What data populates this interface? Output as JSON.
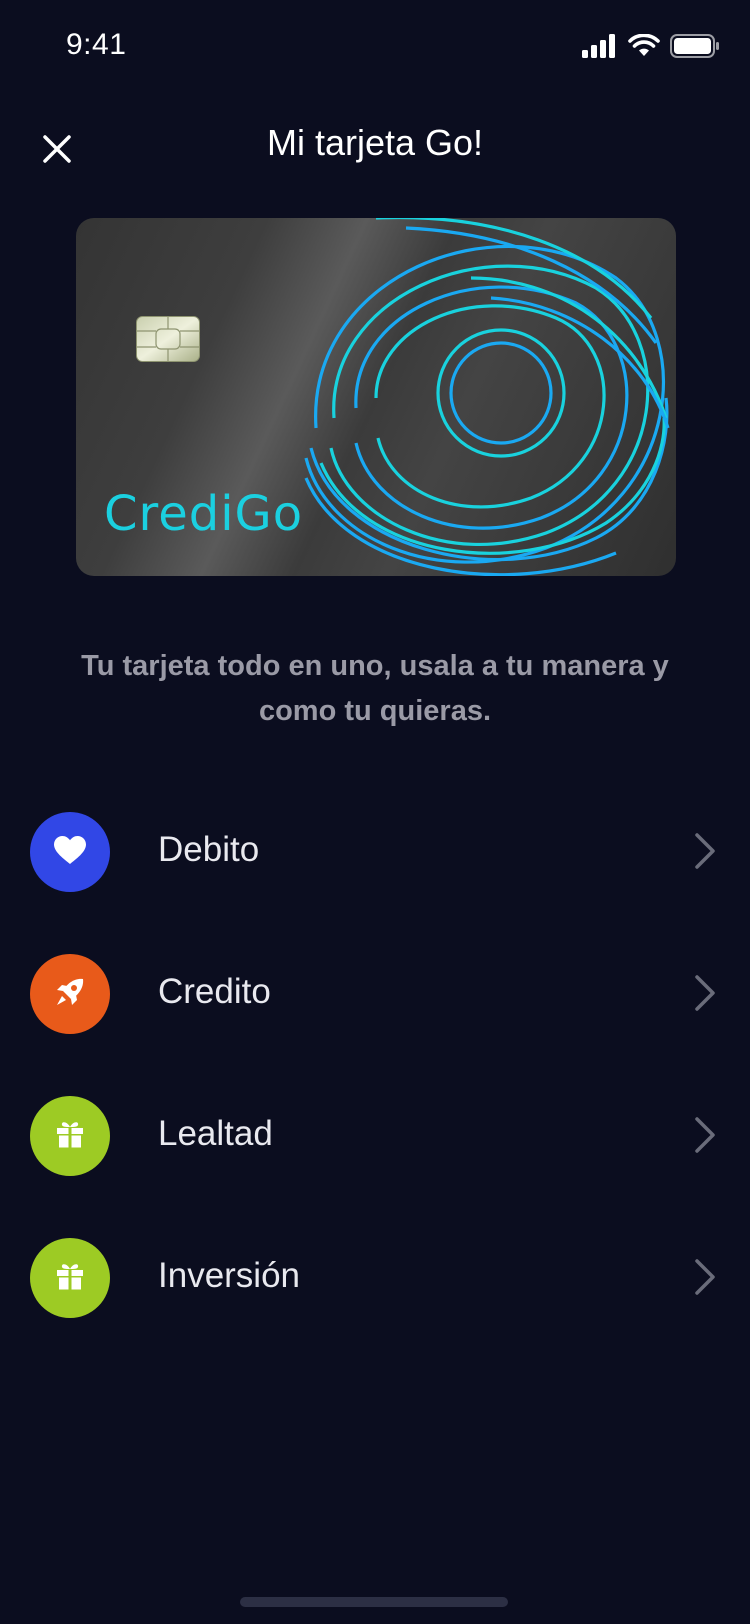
{
  "status_bar": {
    "time": "9:41",
    "signal_icon": "cellular-signal-icon",
    "wifi_icon": "wifi-icon",
    "battery_icon": "battery-icon"
  },
  "header": {
    "title": "Mi tarjeta Go!",
    "close_icon": "close-icon"
  },
  "card": {
    "brand": "CrediGo",
    "chip_icon": "card-chip-icon",
    "brand_color": "#1bd0e0",
    "swirl_colors": [
      "#1aa9f2",
      "#19d2de"
    ]
  },
  "tagline": "Tu tarjeta todo en uno, usala a tu manera y como tu quieras.",
  "options": [
    {
      "label": "Debito",
      "icon": "heart-icon",
      "color": "#3147e6"
    },
    {
      "label": "Credito",
      "icon": "rocket-icon",
      "color": "#e85a1a"
    },
    {
      "label": "Lealtad",
      "icon": "gift-icon",
      "color": "#9dcb24"
    },
    {
      "label": "Inversión",
      "icon": "gift-icon",
      "color": "#9dcb24"
    }
  ],
  "colors": {
    "background": "#0b0d1f",
    "tagline": "#9a9aa6",
    "chevron": "#6a6c7a"
  }
}
